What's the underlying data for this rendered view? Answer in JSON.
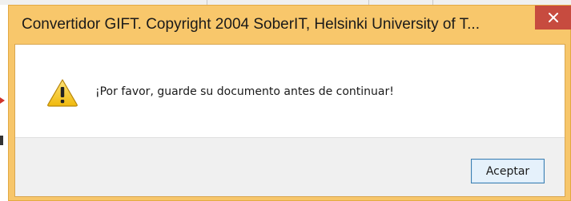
{
  "dialog": {
    "title": "Convertidor GIFT. Copyright 2004 SoberIT, Helsinki University of T...",
    "close_icon": "close-icon",
    "message_icon": "warning-icon",
    "message": "¡Por favor, guarde su documento antes de continuar!",
    "ok_label": "Aceptar"
  },
  "colors": {
    "titlebar": "#f8c76b",
    "close_button": "#c74b3f",
    "button_bar": "#f0f0f0",
    "ok_border": "#3c7fb1",
    "warning_yellow": "#f5c518"
  }
}
